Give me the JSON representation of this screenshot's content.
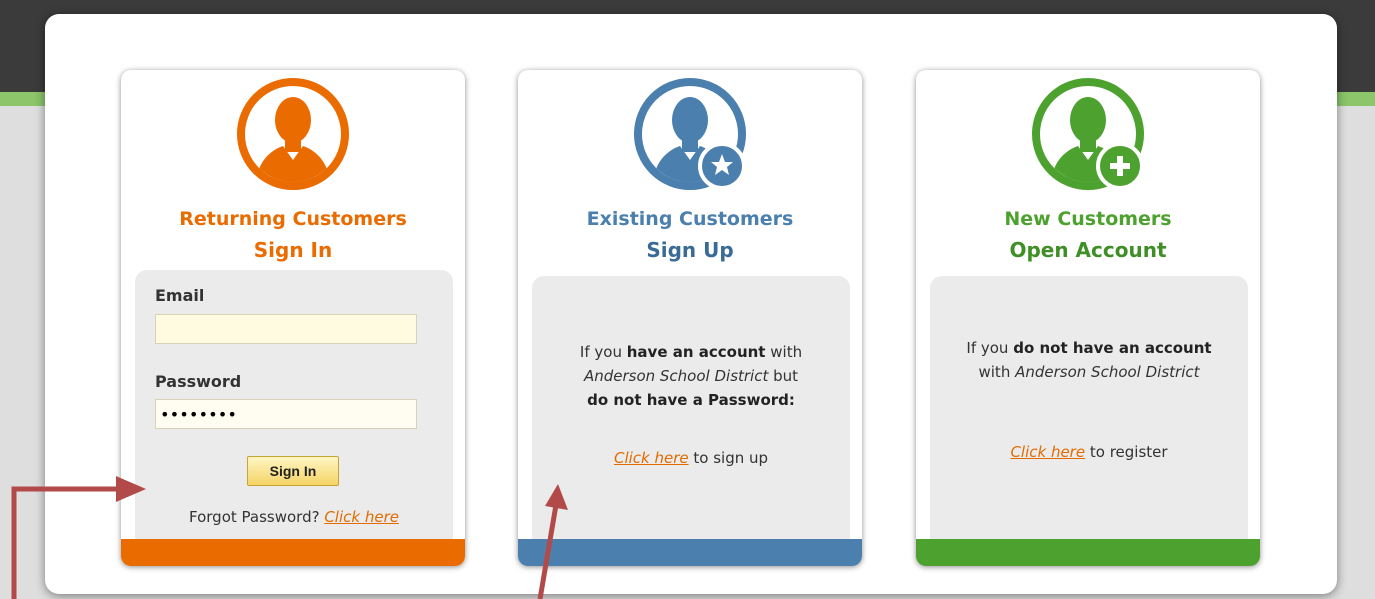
{
  "colors": {
    "orange": "#ea6b00",
    "blue": "#4a7fae",
    "green": "#4da22f",
    "link": "#e26b00",
    "annotation_arrow": "#b34a4a"
  },
  "returning": {
    "title": "Returning Customers",
    "subtitle": "Sign In",
    "email_label": "Email",
    "email_value": "",
    "password_label": "Password",
    "password_value": "••••••••",
    "signin_button": "Sign In",
    "forgot_text": "Forgot Password? ",
    "forgot_link": "Click here",
    "icon": "person-icon"
  },
  "existing": {
    "title": "Existing Customers",
    "subtitle": "Sign Up",
    "line1_pre": "If you ",
    "line1_bold": "have an account",
    "line1_post": " with",
    "line2_italic": "Anderson School District",
    "line2_post": " but",
    "line3_bold": "do not have a Password:",
    "link": "Click here",
    "link_post": " to sign up",
    "icon": "person-star-icon"
  },
  "new": {
    "title": "New Customers",
    "subtitle": "Open Account",
    "line1_pre": "If you ",
    "line1_bold": "do not have an account",
    "line2_pre": "with ",
    "line2_italic": "Anderson School District",
    "link": "Click here",
    "link_post": " to register",
    "icon": "person-plus-icon"
  }
}
